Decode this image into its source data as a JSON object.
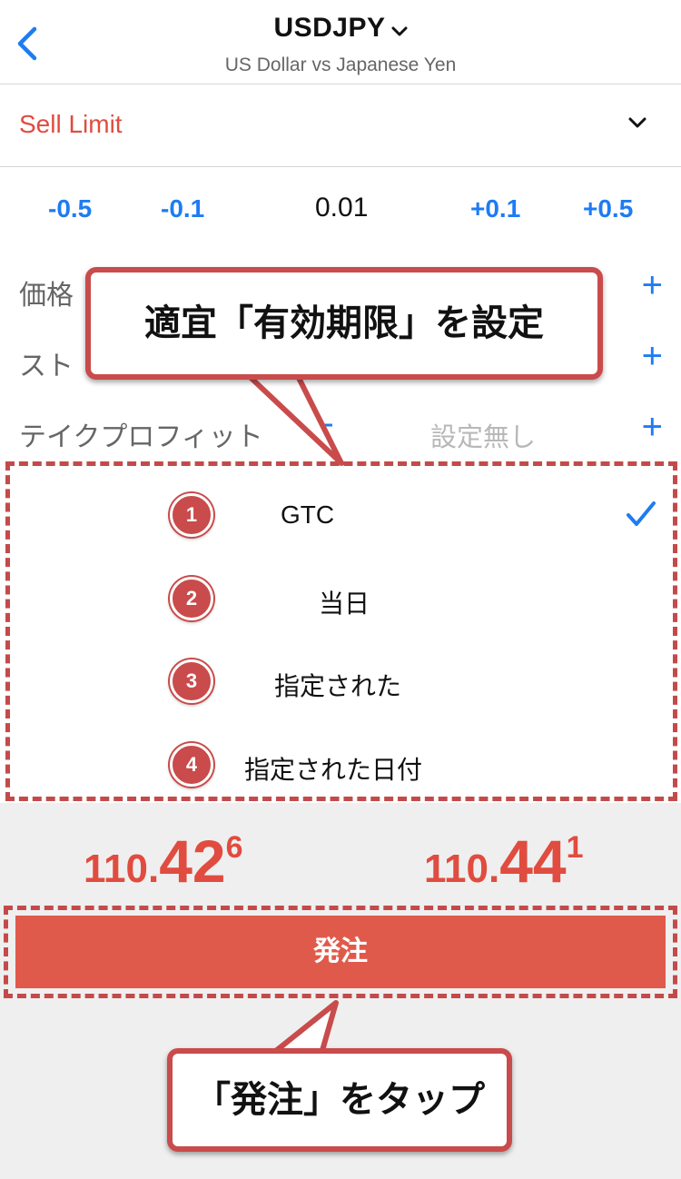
{
  "header": {
    "symbol": "USDJPY",
    "description": "US Dollar vs Japanese Yen"
  },
  "order_type": {
    "label": "Sell Limit"
  },
  "volume": {
    "steps": [
      "-0.5",
      "-0.1",
      "+0.1",
      "+0.5"
    ],
    "value": "0.01"
  },
  "fields": {
    "price_label": "価格",
    "stoploss_label": "スト",
    "takeprofit_label": "テイクプロフィット",
    "takeprofit_minus": "-",
    "takeprofit_value": "設定無し",
    "plus": "+"
  },
  "expiration": {
    "options": [
      {
        "number": "1",
        "label": "GTC",
        "selected": true
      },
      {
        "number": "2",
        "label": "当日",
        "selected": false
      },
      {
        "number": "3",
        "label": "指定された",
        "selected": false
      },
      {
        "number": "4",
        "label": "指定された日付",
        "selected": false
      }
    ]
  },
  "quotes": {
    "bid": {
      "prefix": "110.",
      "big": "42",
      "sup": "6"
    },
    "ask": {
      "prefix": "110.",
      "big": "44",
      "sup": "1"
    }
  },
  "order_button": {
    "label": "発注"
  },
  "annotations": {
    "callout_expiry": "適宜「有効期限」を設定",
    "callout_order": "「発注」をタップ"
  },
  "colors": {
    "accent_blue": "#1e7cf2",
    "sell_red": "#e04c3f",
    "annotation_red": "#c94b4b",
    "button_red": "#e05a4b"
  }
}
